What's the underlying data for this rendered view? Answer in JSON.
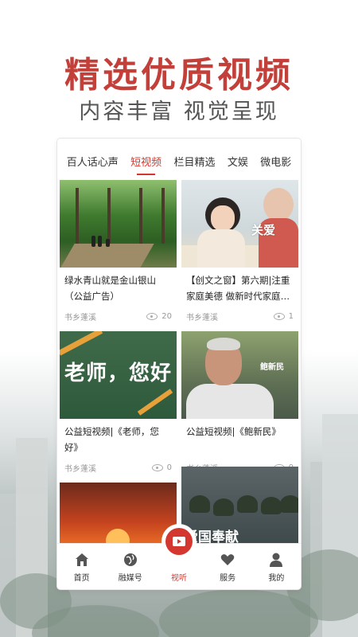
{
  "promo": {
    "headline": "精选优质视频",
    "subhead": "内容丰富 视觉呈现"
  },
  "tabs": [
    "百人话心声",
    "短视频",
    "栏目精选",
    "文娱",
    "微电影"
  ],
  "active_tab": "短视频",
  "videos": [
    {
      "title": "绿水青山就是金山银山（公益广告）",
      "source": "书乡蓬溪",
      "views": "20",
      "thumb": "forest"
    },
    {
      "title": "【创文之窗】第六期|注重家庭美德 做新时代家庭…",
      "source": "书乡蓬溪",
      "views": "1",
      "thumb": "family",
      "caption": "关爱"
    },
    {
      "title": "公益短视频|《老师，您好》",
      "source": "书乡蓬溪",
      "views": "0",
      "thumb": "board",
      "caption": "老师，您好"
    },
    {
      "title": "公益短视频|《鲍新民》",
      "source": "书乡蓬溪",
      "views": "0",
      "thumb": "oldman",
      "caption": "鲍新民"
    },
    {
      "title": "",
      "source": "",
      "views": "",
      "thumb": "sunset"
    },
    {
      "title": "",
      "source": "",
      "views": "",
      "thumb": "soldiers",
      "caption": "爱国奉献"
    }
  ],
  "nav": [
    {
      "label": "首页",
      "icon": "home-icon"
    },
    {
      "label": "融媒号",
      "icon": "globe-icon"
    },
    {
      "label": "视听",
      "icon": "play-icon",
      "active": true
    },
    {
      "label": "服务",
      "icon": "heart-icon"
    },
    {
      "label": "我的",
      "icon": "user-icon"
    }
  ],
  "colors": {
    "accent": "#d4372f",
    "headline": "#c3403a"
  }
}
